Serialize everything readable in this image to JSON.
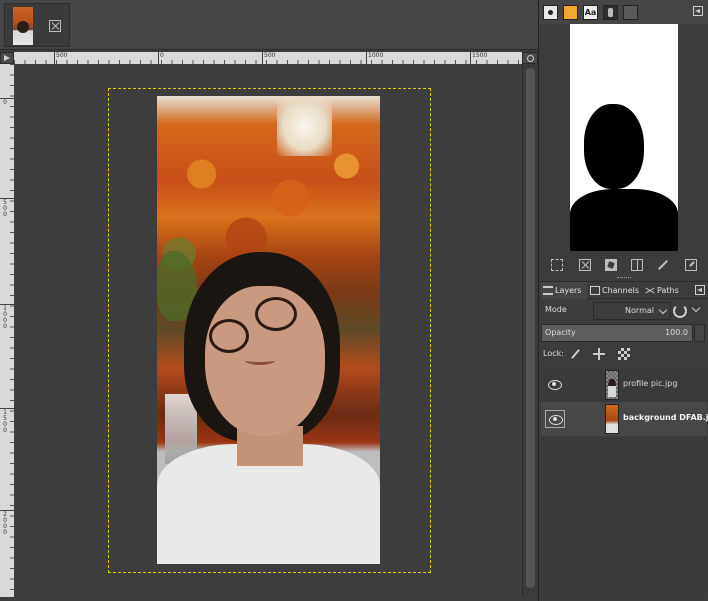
{
  "image_tab": {
    "name": "profile-image-tab"
  },
  "rulers": {
    "h_labels": [
      "500",
      "0",
      "500",
      "1000",
      "1500"
    ],
    "v_labels": [
      "0",
      "500",
      "1000",
      "1500",
      "2000"
    ]
  },
  "dock": {
    "tabs": [
      {
        "icon": "brushes-icon"
      },
      {
        "icon": "patterns-icon"
      },
      {
        "icon": "fonts-icon",
        "label": "Aa"
      },
      {
        "icon": "tool-presets-icon"
      },
      {
        "icon": "color-swatch-icon"
      }
    ]
  },
  "channel_icons": [
    "selection-icon",
    "delete-icon",
    "edit-icon",
    "channel-icon",
    "anchor-icon",
    "merge-icon"
  ],
  "layers_panel": {
    "tabs": [
      {
        "label": "Layers",
        "icon": "layers-icon"
      },
      {
        "label": "Channels",
        "icon": "channels-icon"
      },
      {
        "label": "Paths",
        "icon": "paths-icon"
      }
    ],
    "mode_label": "Mode",
    "mode_value": "Normal",
    "opacity_label": "Opacity",
    "opacity_value": "100.0",
    "lock_label": "Lock:",
    "layers": [
      {
        "name": "profile pic.jpg",
        "visible": true,
        "selected": false
      },
      {
        "name": "background DFAB.jp",
        "visible": true,
        "selected": true
      }
    ]
  },
  "colors": {
    "accent_yellow_boundary": "#d8d000",
    "panel_bg": "#3c3c3c",
    "selected_row": "#474747"
  }
}
